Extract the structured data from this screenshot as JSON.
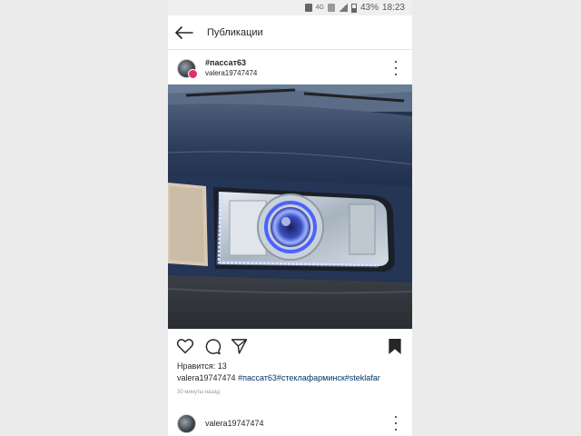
{
  "status_bar": {
    "time": "18:23",
    "battery": "43%",
    "network": "4G"
  },
  "app_bar": {
    "title": "Публикации",
    "back_icon": "back-arrow-icon"
  },
  "post": {
    "hashtag": "#пассат63",
    "username": "valera19747474",
    "image_subject": "car-headlight",
    "likes_label": "Нравится: 13",
    "caption_user": "valera19747474",
    "caption_tags": "#пассат63#стеклафарминск#steklafar",
    "time_ago": "30 минуты назад",
    "actions": {
      "like_icon": "heart-icon",
      "comment_icon": "comment-icon",
      "share_icon": "share-icon",
      "save_icon": "bookmark-icon"
    }
  },
  "next_post": {
    "username": "valera19747474"
  },
  "colors": {
    "accent_link": "#003569",
    "text": "#262626",
    "badge": "#e1306c"
  }
}
